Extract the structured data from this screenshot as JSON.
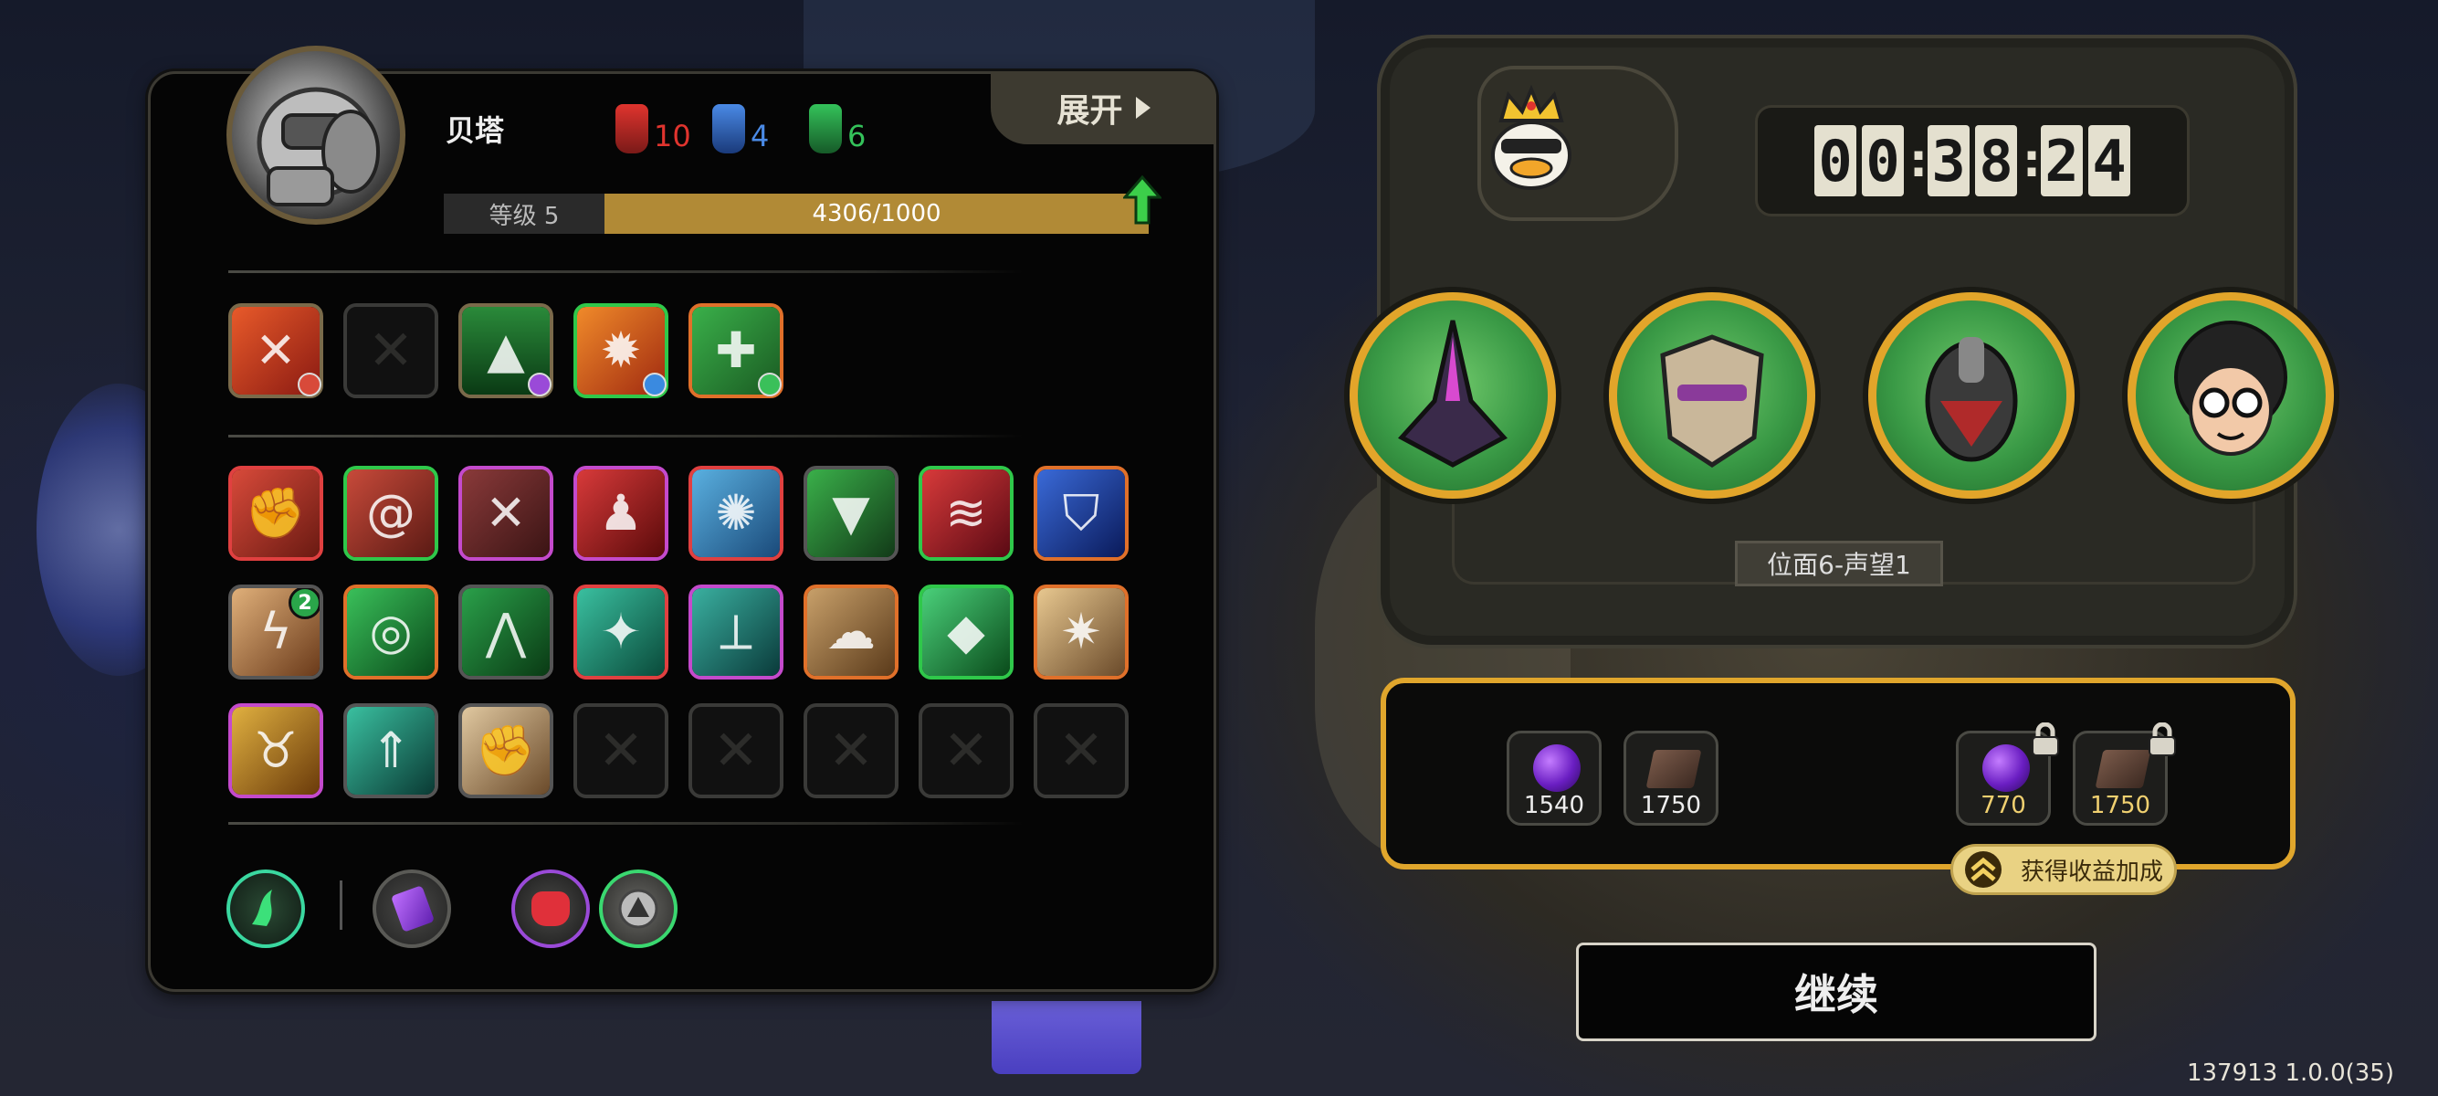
{
  "header": {
    "expand_label": "展开",
    "name": "贝塔",
    "level_label": "等级 5",
    "xp_text": "4306/1000",
    "xp_progress": 1.0
  },
  "resources": [
    {
      "name": "red-totem-icon",
      "value": "10",
      "color": "#e0342e"
    },
    {
      "name": "blue-totem-icon",
      "value": "4",
      "color": "#4a8ae6"
    },
    {
      "name": "green-totem-icon",
      "value": "6",
      "color": "#34c25a"
    }
  ],
  "equipped_skills": [
    {
      "icon": "flame-slash-skill-icon",
      "border": "#7a6a4a",
      "empty": false
    },
    {
      "icon": "empty-slot-icon",
      "border": "#3a3a38",
      "empty": true
    },
    {
      "icon": "green-arrow-skill-icon",
      "border": "#7a6a4a",
      "empty": false
    },
    {
      "icon": "fire-beast-skill-icon",
      "border": "#2fc84a",
      "empty": false
    },
    {
      "icon": "syringe-skill-icon",
      "border": "#e0702a",
      "empty": false
    }
  ],
  "skill_grid": [
    [
      {
        "icon": "fist-hammer-icon",
        "border": "#e04040"
      },
      {
        "icon": "spiral-icon",
        "border": "#2fc84a"
      },
      {
        "icon": "crossed-guns-icon",
        "border": "#c44acc"
      },
      {
        "icon": "red-figure-icon",
        "border": "#c44acc"
      },
      {
        "icon": "ice-shatter-icon",
        "border": "#e04040"
      },
      {
        "icon": "green-cloak-icon",
        "border": "#555"
      },
      {
        "icon": "red-claw-icon",
        "border": "#2fc84a"
      },
      {
        "icon": "blue-shield-icon",
        "border": "#e0702a"
      }
    ],
    [
      {
        "icon": "lightning-burst-icon",
        "border": "#555",
        "badge": "2"
      },
      {
        "icon": "green-vortex-icon",
        "border": "#e0702a"
      },
      {
        "icon": "green-spikes-icon",
        "border": "#555"
      },
      {
        "icon": "green-shuriken-icon",
        "border": "#e04040"
      },
      {
        "icon": "green-blade-icon",
        "border": "#c44acc"
      },
      {
        "icon": "angry-cloud-icon",
        "border": "#e0702a"
      },
      {
        "icon": "green-crystal-icon",
        "border": "#2fc84a"
      },
      {
        "icon": "gear-sun-icon",
        "border": "#e0702a"
      }
    ],
    [
      {
        "icon": "golden-beast-icon",
        "border": "#c44acc"
      },
      {
        "icon": "teal-arrow-icon",
        "border": "#555"
      },
      {
        "icon": "punch-fist-icon",
        "border": "#555"
      },
      {
        "icon": "empty-slot-icon",
        "empty": true
      },
      {
        "icon": "empty-slot-icon",
        "empty": true
      },
      {
        "icon": "empty-slot-icon",
        "empty": true
      },
      {
        "icon": "empty-slot-icon",
        "empty": true
      },
      {
        "icon": "empty-slot-icon",
        "empty": true
      }
    ]
  ],
  "bottom_icons": [
    {
      "icon": "green-wind-icon"
    },
    {
      "icon": "purple-card-icon"
    },
    {
      "icon": "red-fist-icon"
    },
    {
      "icon": "silver-triangle-icon"
    }
  ],
  "timer": {
    "digits": [
      "0",
      "0",
      "3",
      "8",
      "2",
      "4"
    ]
  },
  "heroes": [
    {
      "icon": "dark-blade-hero-icon"
    },
    {
      "icon": "armored-mask-hero-icon"
    },
    {
      "icon": "red-cyborg-hero-icon"
    },
    {
      "icon": "glasses-afro-hero-icon"
    }
  ],
  "position_label": "位面6-声望1",
  "rewards": {
    "free": [
      {
        "icon": "purple-orb-icon",
        "value": "1540"
      },
      {
        "icon": "book-icon",
        "value": "1750"
      }
    ],
    "locked": [
      {
        "icon": "purple-orb-icon",
        "value": "770"
      },
      {
        "icon": "book-icon",
        "value": "1750"
      }
    ]
  },
  "bonus_label": "获得收益加成",
  "continue_label": "继续",
  "version": "137913 1.0.0(35)",
  "colors": {
    "accent": "#e0a62c",
    "orange": "#d96a1e",
    "xp": "#b18a36"
  }
}
